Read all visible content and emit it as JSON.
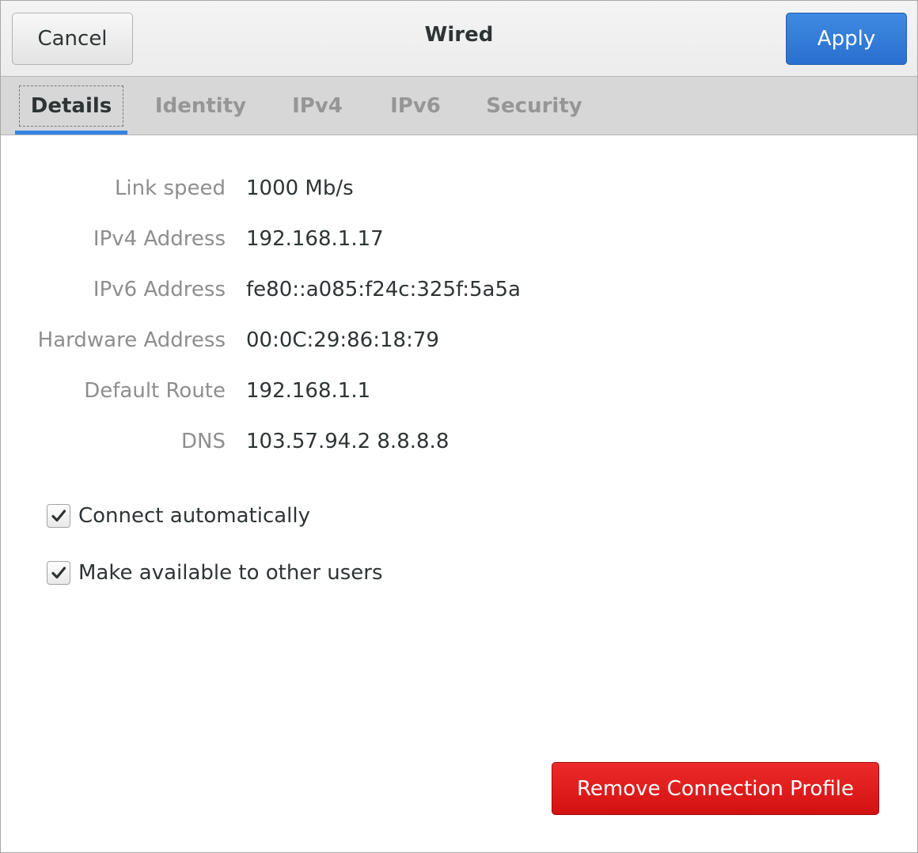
{
  "header": {
    "title": "Wired",
    "cancel_label": "Cancel",
    "apply_label": "Apply"
  },
  "tabs": [
    {
      "label": "Details",
      "active": true
    },
    {
      "label": "Identity",
      "active": false
    },
    {
      "label": "IPv4",
      "active": false
    },
    {
      "label": "IPv6",
      "active": false
    },
    {
      "label": "Security",
      "active": false
    }
  ],
  "details": [
    {
      "label": "Link speed",
      "value": "1000 Mb/s"
    },
    {
      "label": "IPv4 Address",
      "value": "192.168.1.17"
    },
    {
      "label": "IPv6 Address",
      "value": "fe80::a085:f24c:325f:5a5a"
    },
    {
      "label": "Hardware Address",
      "value": "00:0C:29:86:18:79"
    },
    {
      "label": "Default Route",
      "value": "192.168.1.1"
    },
    {
      "label": "DNS",
      "value": "103.57.94.2 8.8.8.8"
    }
  ],
  "options": {
    "connect_automatically": {
      "label": "Connect automatically",
      "checked": true
    },
    "available_to_others": {
      "label": "Make available to other users",
      "checked": true
    }
  },
  "remove_label": "Remove Connection Profile",
  "colors": {
    "accent": "#3584e4",
    "destructive": "#e01b24"
  },
  "icons": {
    "checkbox_checked": "check-icon"
  }
}
